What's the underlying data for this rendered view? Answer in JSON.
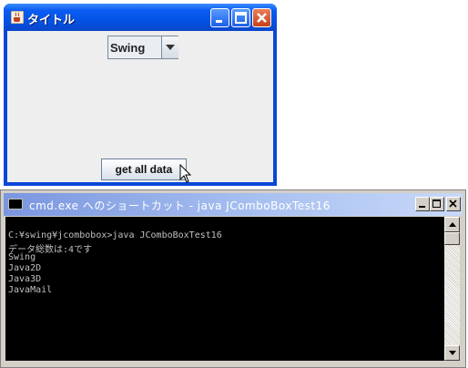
{
  "java_window": {
    "title": "タイトル",
    "combo_value": "Swing",
    "button_label": "get all data"
  },
  "console_window": {
    "title": "cmd.exe へのショートカット - java JComboBoxTest16",
    "lines": [
      "C:¥swing¥jcombobox>java JComboBoxTest16",
      "データ総数は:4です",
      "Swing",
      "Java2D",
      "Java3D",
      "JavaMail"
    ]
  },
  "icons": {
    "java_app": "java-coffee-icon",
    "console_app": "cmd-icon",
    "minimize": "minimize-icon",
    "maximize": "maximize-icon",
    "close": "close-icon",
    "dropdown": "chevron-down-icon",
    "cursor": "mouse-pointer-icon"
  }
}
